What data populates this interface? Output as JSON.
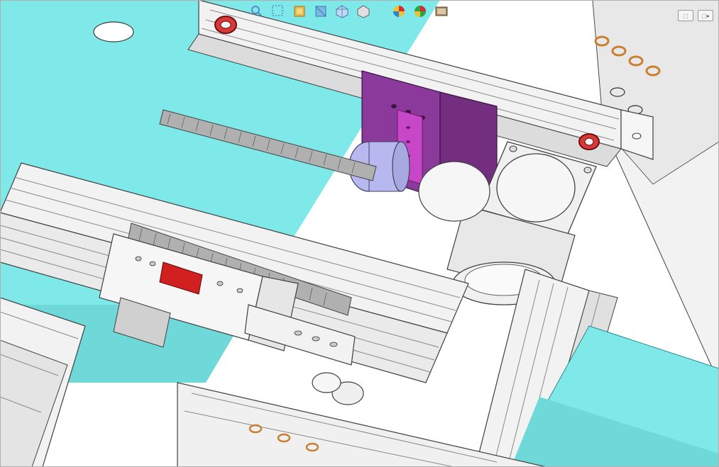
{
  "toolbar": {
    "items": [
      {
        "name": "zoom-fit-icon",
        "tooltip": "Zoom to Fit"
      },
      {
        "name": "zoom-window-icon",
        "tooltip": "Zoom to Area"
      },
      {
        "name": "previous-view-icon",
        "tooltip": "Previous View"
      },
      {
        "name": "section-view-icon",
        "tooltip": "Section View"
      },
      {
        "name": "view-orientation-icon",
        "tooltip": "View Orientation"
      },
      {
        "name": "display-style-icon",
        "tooltip": "Display Style"
      },
      {
        "name": "hide-show-icon",
        "tooltip": "Hide/Show Items"
      },
      {
        "name": "edit-appearance-icon",
        "tooltip": "Edit Appearance"
      },
      {
        "name": "apply-scene-icon",
        "tooltip": "Apply Scene"
      },
      {
        "name": "view-settings-icon",
        "tooltip": "View Settings"
      }
    ]
  },
  "panel_icons": {
    "left_label": "⬚",
    "right_label": "⬚▸"
  },
  "model": {
    "description": "CAD assembly isometric view: aluminum extrusion frame with linear rails, lead screws, stepper motor, cyan surface plate, purple/magenta brackets",
    "colors": {
      "plate": "#7fe9e9",
      "extrusion_light": "#f2f2f2",
      "extrusion_shadow": "#dcdcdc",
      "bracket_purple": "#8b3a9b",
      "bracket_magenta": "#c847c8",
      "coupler": "#b8b8f0",
      "motor_body": "#f0f0f0",
      "screw_thread": "#b0b0b0",
      "ring_red": "#d93838",
      "carriage_red": "#d02020",
      "orange_ring": "#c98030",
      "edge": "#404040"
    }
  }
}
